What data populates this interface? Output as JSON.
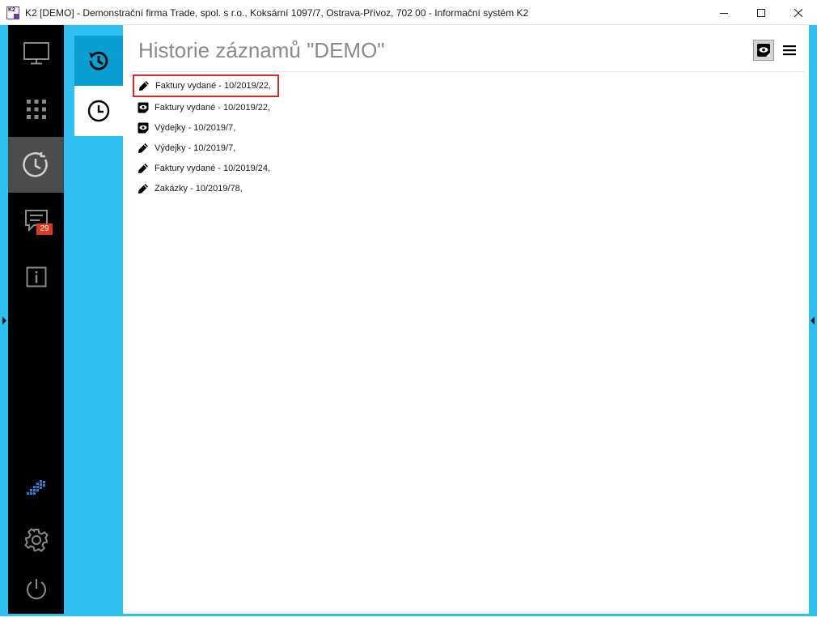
{
  "window": {
    "logo_text": "K2",
    "title": "K2 [DEMO] - Demonstrační firma Trade, spol. s r.o., Koksární 1097/7, Ostrava-Přívoz, 702 00 - Informační systém K2",
    "controls": [
      "minimize-icon",
      "maximize-icon",
      "close-icon"
    ]
  },
  "sidebar": {
    "items": [
      {
        "id": "desktop",
        "icon": "monitor-icon"
      },
      {
        "id": "apps",
        "icon": "grid-icon"
      },
      {
        "id": "history",
        "icon": "clock-icon",
        "active": true
      },
      {
        "id": "messages",
        "icon": "chat-icon",
        "badge": "29"
      },
      {
        "id": "info",
        "icon": "info-icon"
      }
    ],
    "bottom_items": [
      {
        "id": "k2-logo",
        "icon": "k2-logo-icon"
      },
      {
        "id": "settings",
        "icon": "gear-icon"
      },
      {
        "id": "power",
        "icon": "power-icon"
      }
    ]
  },
  "subpanel": {
    "tabs": [
      {
        "id": "history",
        "icon": "history-icon",
        "active": true
      },
      {
        "id": "recent",
        "icon": "clock-icon"
      }
    ]
  },
  "main": {
    "title": "Historie záznamů \"DEMO\"",
    "toolbar": {
      "view_toggle_icon": "preview-icon",
      "menu_icon": "hamburger-icon"
    },
    "items": [
      {
        "label": "Faktury vydané - 10/2019/22,",
        "icon": "pencil-icon",
        "selected": true
      },
      {
        "label": "Faktury vydané - 10/2019/22,",
        "icon": "eye-icon"
      },
      {
        "label": "Výdejky - 10/2019/7,",
        "icon": "eye-icon"
      },
      {
        "label": "Výdejky - 10/2019/7,",
        "icon": "pencil-icon"
      },
      {
        "label": "Faktury vydané - 10/2019/24,",
        "icon": "pencil-icon"
      },
      {
        "label": "Zakázky - 10/2019/78,",
        "icon": "pencil-icon"
      }
    ]
  },
  "colors": {
    "accent": "#2ec0f0",
    "accent_dark": "#0a9fd3",
    "sidebar_bg": "#000000",
    "sidebar_active": "#4c4c4c",
    "badge": "#e03a1e",
    "selection_border": "#d42a2a"
  }
}
